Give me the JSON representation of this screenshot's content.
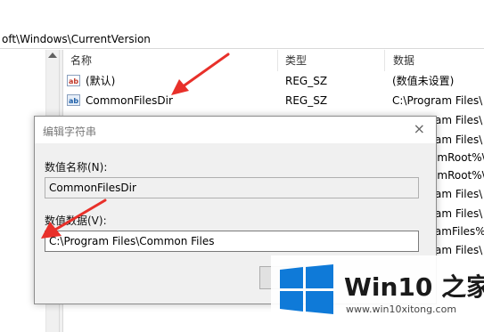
{
  "address": {
    "path": "oft\\Windows\\CurrentVersion"
  },
  "columns": {
    "name": "名称",
    "type": "类型",
    "data": "数据"
  },
  "rows": [
    {
      "icon": "ab",
      "name": "(默认)",
      "type": "REG_SZ",
      "data": "(数值未设置)"
    },
    {
      "icon": "ab",
      "name": "CommonFilesDir",
      "type": "REG_SZ",
      "data": "C:\\Program Files\\"
    },
    {
      "data": "C:\\Program Files\\"
    },
    {
      "data": "C:\\Program Files\\"
    },
    {
      "data": "emRoot%\\"
    },
    {
      "data": "emRoot%\\"
    },
    {
      "data": "C:\\Program Files\\"
    },
    {
      "data": "C:\\Program Files\\"
    },
    {
      "data": "ramFiles%"
    },
    {
      "data": "C:\\Program Files\\"
    }
  ],
  "dialog": {
    "title": "编辑字符串",
    "close": "×",
    "value_name_label": "数值名称(N):",
    "value_name": "CommonFilesDir",
    "value_data_label": "数值数据(V):",
    "value_data": "C:\\Program Files\\Common Files"
  },
  "watermark": {
    "brand": "Win10",
    "brand_zh": "之家",
    "url": "www.win10xitong.com"
  },
  "colors": {
    "arrow": "#e8302a",
    "logo": "#0f7ad8"
  }
}
